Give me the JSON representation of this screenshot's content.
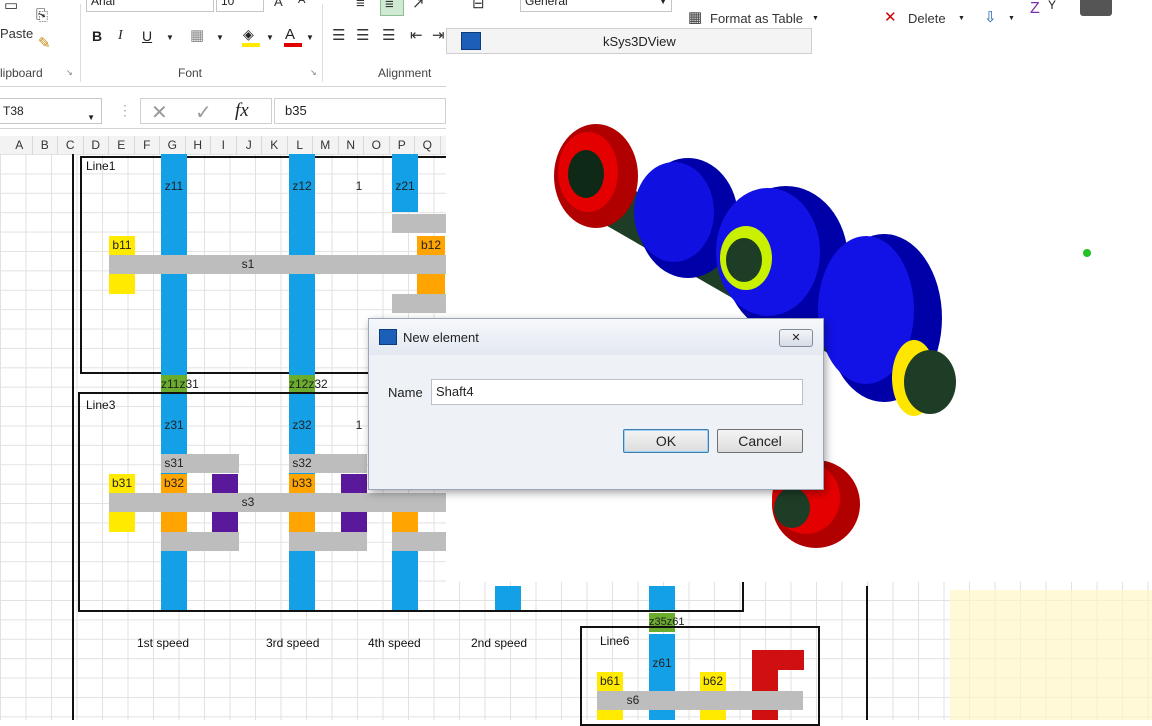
{
  "ribbon": {
    "paste_label": "Paste",
    "font_name": "Arial",
    "font_size": "10",
    "number_format": "General",
    "format_as_table": "Format as Table",
    "delete_label": "Delete",
    "groups": {
      "clipboard": "lipboard",
      "font": "Font",
      "alignment": "Alignment"
    },
    "buttons": {
      "bold": "B",
      "italic": "I",
      "underline": "U",
      "font_color": "A",
      "grow_font": "A",
      "sort_z": "Z"
    }
  },
  "formula_bar": {
    "name_box": "T38",
    "cancel_symbol": "✕",
    "enter_symbol": "✓",
    "fx_symbol": "fx",
    "formula": "b35"
  },
  "columns": [
    "A",
    "B",
    "C",
    "D",
    "E",
    "F",
    "G",
    "H",
    "I",
    "J",
    "K",
    "L",
    "M",
    "N",
    "O",
    "P",
    "Q"
  ],
  "sheet": {
    "line1": {
      "title": "Line1",
      "z11": "z11",
      "z12": "z12",
      "one": "1",
      "z21": "z21",
      "b11": "b11",
      "b12": "b12",
      "s1": "s1"
    },
    "between": {
      "z11z31": "z11z31",
      "z12z32": "z12z32"
    },
    "line3": {
      "title": "Line3",
      "z31": "z31",
      "z32": "z32",
      "one": "1",
      "s31": "s31",
      "s32": "s32",
      "b31": "b31",
      "b32": "b32",
      "b33": "b33",
      "s3": "s3"
    },
    "speeds": {
      "first": "1st speed",
      "third": "3rd speed",
      "fourth": "4th speed",
      "second": "2nd speed"
    },
    "line6": {
      "title": "Line6",
      "z35z61": "z35z61",
      "z61": "z61",
      "b61": "b61",
      "b62": "b62",
      "s6": "s6"
    }
  },
  "view3d": {
    "title": "kSys3DView"
  },
  "dialog": {
    "title": "New element",
    "close_symbol": "✕",
    "name_label": "Name",
    "name_value": "Shaft4",
    "ok_label": "OK",
    "cancel_label": "Cancel"
  },
  "colors": {
    "shaft_blue": "#13a0e6",
    "bearing_yellow": "#ffea00",
    "orange": "#ffa400",
    "gray": "#bdbdbd",
    "green": "#6aac2c",
    "purple": "#5a189a",
    "red": "#d01010"
  }
}
